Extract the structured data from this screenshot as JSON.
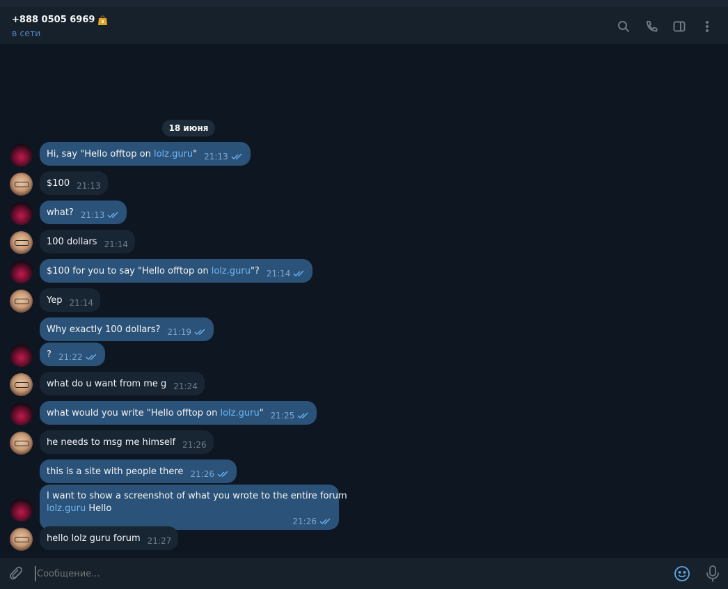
{
  "header": {
    "title": "+888 0505 6969",
    "status": "в сети",
    "icons": [
      "search-icon",
      "phone-icon",
      "sidebar-toggle-icon",
      "more-icon"
    ]
  },
  "chat": {
    "date": "18 июня",
    "messages": [
      {
        "dir": "out",
        "parts": [
          {
            "t": "Hi, say \"Hello offtop on "
          },
          {
            "t": "lolz.guru",
            "link": true
          },
          {
            "t": "\""
          }
        ],
        "time": "21:13",
        "avatar": true
      },
      {
        "dir": "in",
        "parts": [
          {
            "t": "$100"
          }
        ],
        "time": "21:13",
        "avatar": true
      },
      {
        "dir": "out",
        "parts": [
          {
            "t": "what?"
          }
        ],
        "time": "21:13",
        "avatar": true
      },
      {
        "dir": "in",
        "parts": [
          {
            "t": "100 dollars"
          }
        ],
        "time": "21:14",
        "avatar": true
      },
      {
        "dir": "out",
        "parts": [
          {
            "t": "$100 for you to say \"Hello offtop on "
          },
          {
            "t": "lolz.guru",
            "link": true
          },
          {
            "t": "\"?"
          }
        ],
        "time": "21:14",
        "avatar": true
      },
      {
        "dir": "in",
        "parts": [
          {
            "t": "Yep"
          }
        ],
        "time": "21:14",
        "avatar": true
      },
      {
        "dir": "out",
        "parts": [
          {
            "t": "Why exactly 100 dollars?"
          }
        ],
        "time": "21:19",
        "avatar": false
      },
      {
        "dir": "out",
        "parts": [
          {
            "t": "?"
          }
        ],
        "time": "21:22",
        "avatar": true
      },
      {
        "dir": "in",
        "parts": [
          {
            "t": "what do u want from me g"
          }
        ],
        "time": "21:24",
        "avatar": true
      },
      {
        "dir": "out",
        "parts": [
          {
            "t": "what would you write \"Hello offtop on "
          },
          {
            "t": "lolz.guru",
            "link": true
          },
          {
            "t": "\""
          }
        ],
        "time": "21:25",
        "avatar": true
      },
      {
        "dir": "in",
        "parts": [
          {
            "t": "he needs to msg me himself"
          }
        ],
        "time": "21:26",
        "avatar": true
      },
      {
        "dir": "out",
        "parts": [
          {
            "t": "this is a site with people there"
          }
        ],
        "time": "21:26",
        "avatar": false
      },
      {
        "dir": "out",
        "parts": [
          {
            "t": "I want to show a screenshot of what you wrote to the entire forum"
          },
          {
            "t": "lolz.guru",
            "link": true,
            "br": true
          },
          {
            "t": " Hello"
          }
        ],
        "time": "21:26",
        "avatar": true,
        "multiline": true
      },
      {
        "dir": "in",
        "parts": [
          {
            "t": "hello lolz guru forum"
          }
        ],
        "time": "21:27",
        "avatar": true
      }
    ]
  },
  "composer": {
    "placeholder": "Сообщение...",
    "icons": [
      "attach-icon",
      "emoji-icon",
      "microphone-icon"
    ]
  },
  "colors": {
    "background": "#0e1621",
    "header": "#17212b",
    "outgoing_bubble": "#2b5278",
    "incoming_bubble": "#182533",
    "link": "#71b7f5",
    "status": "#5288c1"
  }
}
